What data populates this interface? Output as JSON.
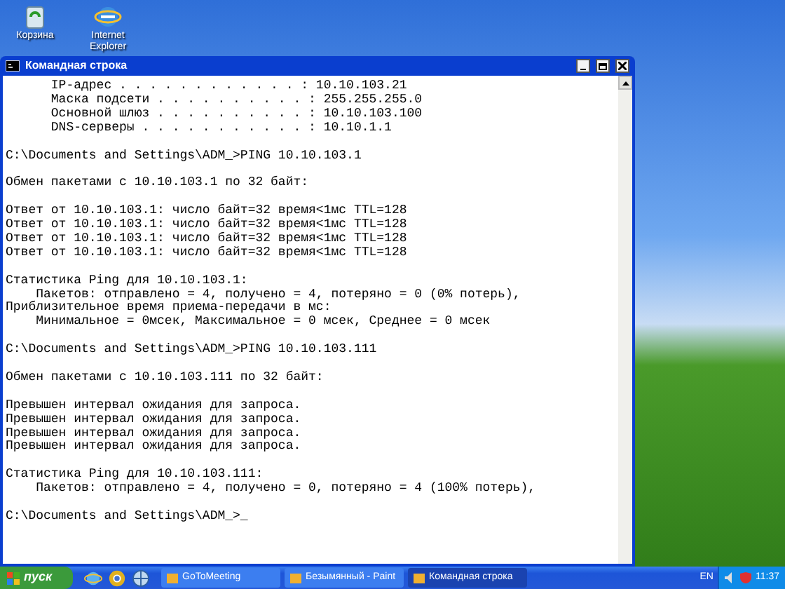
{
  "desktop_icons": [
    {
      "kind": "bin",
      "label": "Корзина"
    },
    {
      "kind": "ie",
      "label": "Internet Explorer"
    }
  ],
  "window": {
    "title": "Командная строка",
    "console_blocks": [
      [
        "      IP-адрес . . . . . . . . . . . . : 10.10.103.21",
        "      Маска подсети . . . . . . . . . . : 255.255.255.0",
        "      Основной шлюз . . . . . . . . . . : 10.10.103.100",
        "      DNS-серверы . . . . . . . . . . . : 10.10.1.1"
      ],
      [
        "C:\\Documents and Settings\\ADM_>PING 10.10.103.1"
      ],
      [
        "Обмен пакетами с 10.10.103.1 по 32 байт:"
      ],
      [
        "Ответ от 10.10.103.1: число байт=32 время<1мс TTL=128",
        "Ответ от 10.10.103.1: число байт=32 время<1мс TTL=128",
        "Ответ от 10.10.103.1: число байт=32 время<1мс TTL=128",
        "Ответ от 10.10.103.1: число байт=32 время<1мс TTL=128"
      ],
      [
        "Статистика Ping для 10.10.103.1:",
        "    Пакетов: отправлено = 4, получено = 4, потеряно = 0 (0% потерь),",
        "Приблизительное время приема-передачи в мс:",
        "    Минимальное = 0мсек, Максимальное = 0 мсек, Среднее = 0 мсек"
      ],
      [
        "C:\\Documents and Settings\\ADM_>PING 10.10.103.111"
      ],
      [
        "Обмен пакетами с 10.10.103.111 по 32 байт:"
      ],
      [
        "Превышен интервал ожидания для запроса.",
        "Превышен интервал ожидания для запроса.",
        "Превышен интервал ожидания для запроса.",
        "Превышен интервал ожидания для запроса."
      ],
      [
        "Статистика Ping для 10.10.103.111:",
        "    Пакетов: отправлено = 4, получено = 0, потеряно = 4 (100% потерь),"
      ],
      [
        "C:\\Documents and Settings\\ADM_>_"
      ]
    ]
  },
  "taskbar": {
    "start": "пуск",
    "quick_launch": [
      {
        "kind": "ie"
      },
      {
        "kind": "chrome"
      },
      {
        "kind": "globe"
      }
    ],
    "tasks": [
      {
        "label": "GoToMeeting",
        "selected": false
      },
      {
        "label": "Безымянный - Paint",
        "selected": false
      },
      {
        "label": "Командная строка",
        "selected": true
      }
    ],
    "language": "EN",
    "time": "11:37"
  }
}
